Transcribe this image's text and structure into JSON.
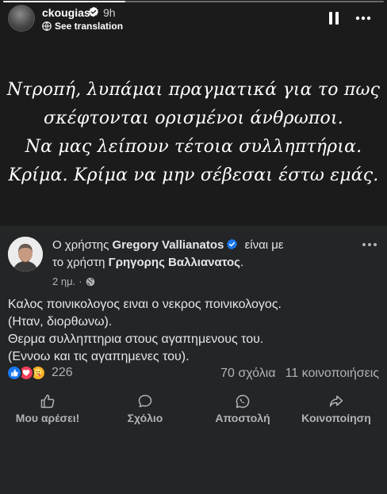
{
  "story": {
    "progress": 0.32,
    "username": "ckougias",
    "time": "9h",
    "translate_label": "See translation",
    "caption_lines": [
      "Ντροπή, λυπάμαι πραγματικά για το πως",
      "σκέφτονται ορισμένοι άνθρωποι.",
      "Να μας λείπουν τέτοια συλληπτήρια.",
      "Κρίμα. Κρίμα να μην σέβεσαι έστω εμάς."
    ]
  },
  "post": {
    "header_prefix": "Ο χρήστης",
    "author": "Gregory Vallianatos",
    "header_mid": "είναι με",
    "header_prefix2": "το χρήστη",
    "tagged": "Γρηγορης Βαλλιανατος",
    "header_end": ".",
    "age": "2 ημ.",
    "body_lines": [
      "Καλος ποινικολογος ειναι ο νεκρος ποινικολογος.",
      "(Ηταν, διορθωνω).",
      "Θερμα συλληπτηρια στους αγαπημενους του.",
      "(Εννοω και τις αγαπημενες του)."
    ],
    "reaction_count": "226",
    "comments": "70 σχόλια",
    "shares": "11 κοινοποιήσεις",
    "actions": {
      "like": "Μου αρέσει!",
      "comment": "Σχόλιο",
      "send": "Αποστολή",
      "share": "Κοινοποίηση"
    }
  },
  "colors": {
    "background": "#1b1b1b",
    "card": "#242526",
    "verified": "#1877f2",
    "text_secondary": "#b0b3b8"
  },
  "icons": [
    "verified-badge-icon",
    "translate-icon",
    "pause-icon",
    "more-icon",
    "globe-icon",
    "like-reaction-icon",
    "love-reaction-icon",
    "care-reaction-icon",
    "thumbs-up-icon",
    "comment-bubble-icon",
    "whatsapp-icon",
    "share-arrow-icon"
  ]
}
